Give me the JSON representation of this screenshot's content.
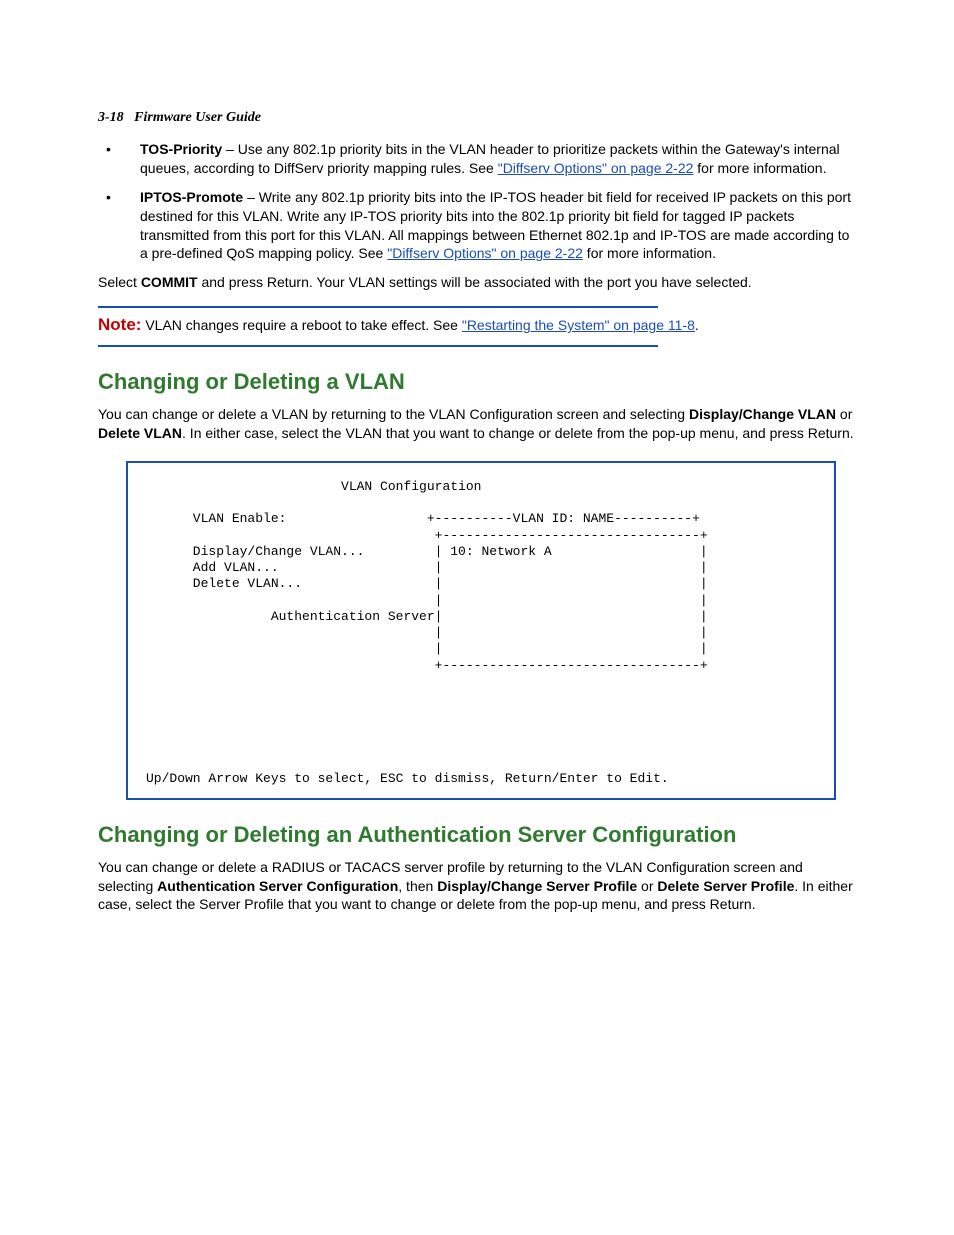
{
  "header": {
    "page_id": "3-18",
    "guide": "Firmware User Guide"
  },
  "bullet1": {
    "term": "TOS-Priority",
    "text_a": " – Use any 802.1p priority bits in the VLAN header to prioritize packets within the Gateway's internal queues, according to DiffServ priority mapping rules. See ",
    "link": "\"Diffserv Options\" on page 2-22",
    "text_b": " for more information."
  },
  "bullet2": {
    "term": "IPTOS-Promote",
    "text_a": " – Write any 802.1p priority bits into the IP-TOS header bit field for received IP packets on this port destined for this VLAN. Write any IP-TOS priority bits into the 802.1p priority bit field for tagged IP packets transmitted from this port for this VLAN. All mappings between Ethernet 802.1p and IP-TOS are made according to a pre-defined QoS mapping policy. See ",
    "link": "\"Diffserv Options\" on page 2-22",
    "text_b": " for more information."
  },
  "commit_para": {
    "a": "Select ",
    "b": "COMMIT",
    "c": " and press Return. Your VLAN settings will be associated with the port you have selected."
  },
  "note": {
    "label": "Note:",
    "text_a": "  VLAN changes require a reboot to take effect. See ",
    "link": "\"Restarting the System\" on page 11-8",
    "text_b": "."
  },
  "section1": {
    "title": "Changing or Deleting a VLAN",
    "p_a": "You can change or delete a VLAN by returning to the VLAN Configuration screen and selecting ",
    "b1": "Display/Change VLAN",
    "p_b": " or ",
    "b2": "Delete VLAN",
    "p_c": ". In either case, select the VLAN that you want to change or delete from the pop-up menu, and press Return."
  },
  "terminal": "                         VLAN Configuration\n\n      VLAN Enable:                  +----------VLAN ID: NAME----------+\n                                     +---------------------------------+\n      Display/Change VLAN...         | 10: Network A                   |\n      Add VLAN...                    |                                 |\n      Delete VLAN...                 |                                 |\n                                     |                                 |\n                Authentication Server|                                 |\n                                     |                                 |\n                                     |                                 |\n                                     +---------------------------------+\n\n\n\n\n\n\nUp/Down Arrow Keys to select, ESC to dismiss, Return/Enter to Edit.",
  "section2": {
    "title": "Changing or Deleting an Authentication Server Configuration",
    "p_a": "You can change or delete a RADIUS or TACACS server profile by returning to the VLAN Configuration screen and selecting ",
    "b1": "Authentication Server Configuration",
    "p_b": ", then ",
    "b2": "Display/Change Server Profile",
    "p_c": " or ",
    "b3": "Delete Server Profile",
    "p_d": ". In either case, select the Server Profile that you want to change or delete from the pop-up menu, and press Return."
  }
}
